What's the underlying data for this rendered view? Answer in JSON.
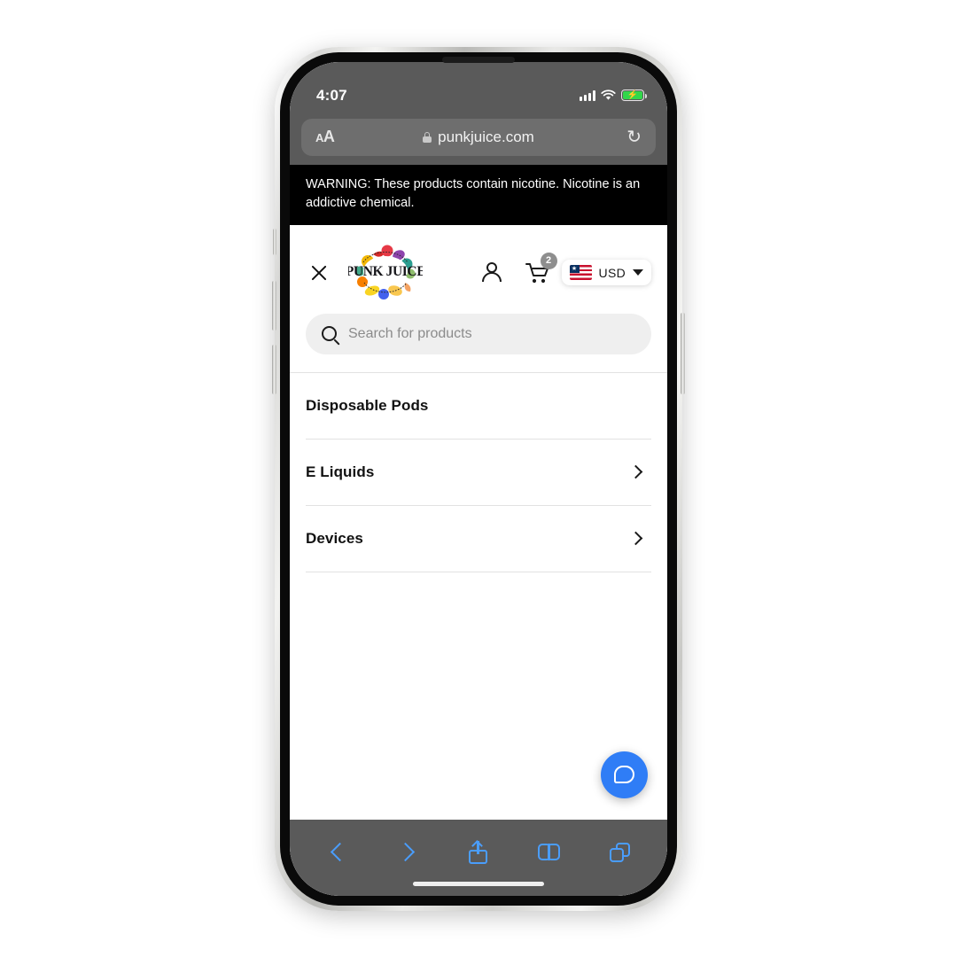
{
  "status_bar": {
    "time": "4:07",
    "signal_icon": "cellular-signal-icon",
    "wifi_icon": "wifi-icon",
    "battery_icon": "battery-charging-icon",
    "battery_bolt": "⚡"
  },
  "browser": {
    "text_size_small": "A",
    "text_size_large": "A",
    "lock_icon": "lock-icon",
    "url": "punkjuice.com",
    "reload_icon": "↻",
    "toolbar": {
      "back": "back-icon",
      "forward": "forward-icon",
      "share": "share-icon",
      "bookmarks": "bookmarks-icon",
      "tabs": "tabs-icon"
    }
  },
  "warning": {
    "text": "WARNING: These products contain nicotine. Nicotine is an addictive chemical."
  },
  "header": {
    "close_label": "close-menu",
    "logo_line1": "PUNK",
    "logo_line2": "JUICE",
    "account_icon": "account-icon",
    "cart_icon": "cart-icon",
    "cart_count": "2",
    "currency": "USD",
    "flag_star": "★"
  },
  "search": {
    "placeholder": "Search for products",
    "value": ""
  },
  "menu": {
    "items": [
      {
        "label": "Disposable Pods",
        "has_chevron": false
      },
      {
        "label": "E Liquids",
        "has_chevron": true
      },
      {
        "label": "Devices",
        "has_chevron": true
      }
    ]
  },
  "chat": {
    "icon": "chat-bubble-icon"
  },
  "colors": {
    "accent_blue": "#2f7df6",
    "safari_chrome": "#5a5a5a",
    "toolbar_blue": "#4a9dfb",
    "warning_bg": "#000000",
    "battery_green": "#32d74b"
  }
}
